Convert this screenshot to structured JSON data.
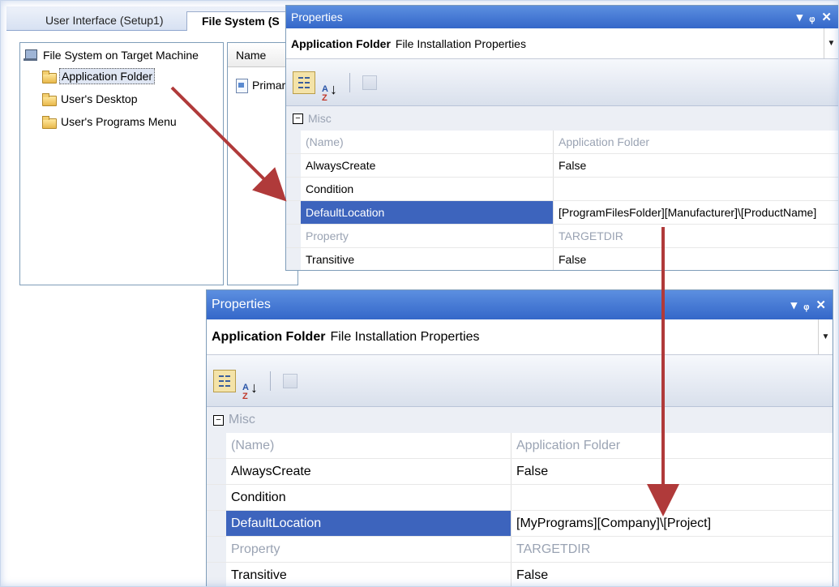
{
  "editor": {
    "tabs": [
      {
        "label": "User Interface (Setup1)"
      },
      {
        "label": "File System (S"
      }
    ],
    "tree": {
      "root": "File System on Target Machine",
      "items": [
        {
          "label": "Application Folder"
        },
        {
          "label": "User's Desktop"
        },
        {
          "label": "User's Programs Menu"
        }
      ]
    },
    "list": {
      "header": "Name",
      "item": "Primar"
    }
  },
  "props_top": {
    "title": "Properties",
    "object_name": "Application Folder",
    "object_type": "File Installation Properties",
    "category": "Misc",
    "rows": [
      {
        "name": "(Name)",
        "value": "Application Folder"
      },
      {
        "name": "AlwaysCreate",
        "value": "False"
      },
      {
        "name": "Condition",
        "value": ""
      },
      {
        "name": "DefaultLocation",
        "value": "[ProgramFilesFolder][Manufacturer]\\[ProductName]"
      },
      {
        "name": "Property",
        "value": "TARGETDIR"
      },
      {
        "name": "Transitive",
        "value": "False"
      }
    ]
  },
  "props_bottom": {
    "title": "Properties",
    "object_name": "Application Folder",
    "object_type": "File Installation Properties",
    "category": "Misc",
    "rows": [
      {
        "name": "(Name)",
        "value": "Application Folder"
      },
      {
        "name": "AlwaysCreate",
        "value": "False"
      },
      {
        "name": "Condition",
        "value": ""
      },
      {
        "name": "DefaultLocation",
        "value": "[MyPrograms][Company]\\[Project]"
      },
      {
        "name": "Property",
        "value": "TARGETDIR"
      },
      {
        "name": "Transitive",
        "value": "False"
      }
    ]
  },
  "colors": {
    "titlebar": "#3467c9",
    "selection": "#3d64bd",
    "arrow": "#b03a3a"
  },
  "icons": [
    "pc-icon",
    "folder-icon",
    "document-icon",
    "categorized-icon",
    "alphabetical-icon",
    "property-pages-icon",
    "dropdown-icon",
    "pin-icon",
    "close-icon",
    "collapse-icon"
  ]
}
